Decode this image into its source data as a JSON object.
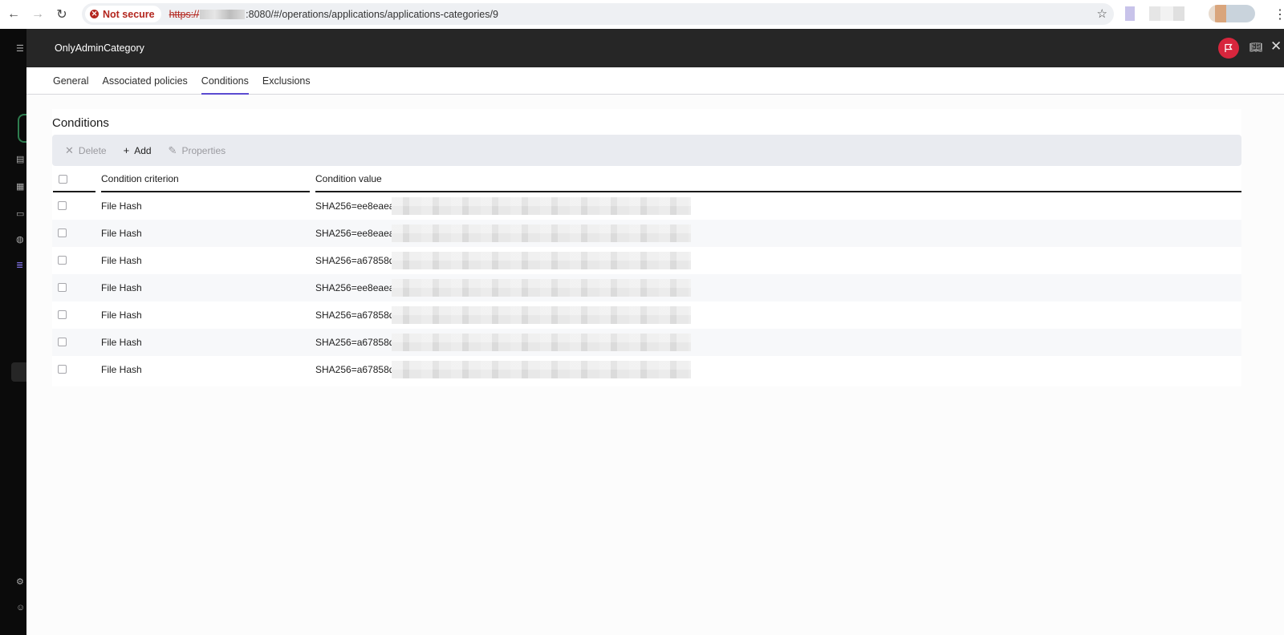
{
  "browser": {
    "security_label": "Not secure",
    "url_scheme": "https://",
    "url_rest": ":8080/#/operations/applications/applications-categories/9"
  },
  "drawer": {
    "title": "OnlyAdminCategory",
    "tabs": [
      {
        "label": "General",
        "active": false
      },
      {
        "label": "Associated policies",
        "active": false
      },
      {
        "label": "Conditions",
        "active": true
      },
      {
        "label": "Exclusions",
        "active": false
      }
    ]
  },
  "conditions": {
    "title": "Conditions",
    "toolbar": {
      "delete_label": "Delete",
      "add_label": "Add",
      "properties_label": "Properties"
    },
    "columns": {
      "criterion": "Condition criterion",
      "value": "Condition value"
    },
    "rows": [
      {
        "criterion": "File Hash",
        "value": "SHA256=ee8eaea"
      },
      {
        "criterion": "File Hash",
        "value": "SHA256=ee8eaea"
      },
      {
        "criterion": "File Hash",
        "value": "SHA256=a67858d"
      },
      {
        "criterion": "File Hash",
        "value": "SHA256=ee8eaea"
      },
      {
        "criterion": "File Hash",
        "value": "SHA256=a67858d"
      },
      {
        "criterion": "File Hash",
        "value": "SHA256=a67858d"
      },
      {
        "criterion": "File Hash",
        "value": "SHA256=a67858d"
      }
    ]
  },
  "colors": {
    "accent": "#5b4bd1",
    "header_bg": "#262626",
    "flag_button": "#d7263d",
    "toolbar_bg": "#e9ebf0"
  }
}
